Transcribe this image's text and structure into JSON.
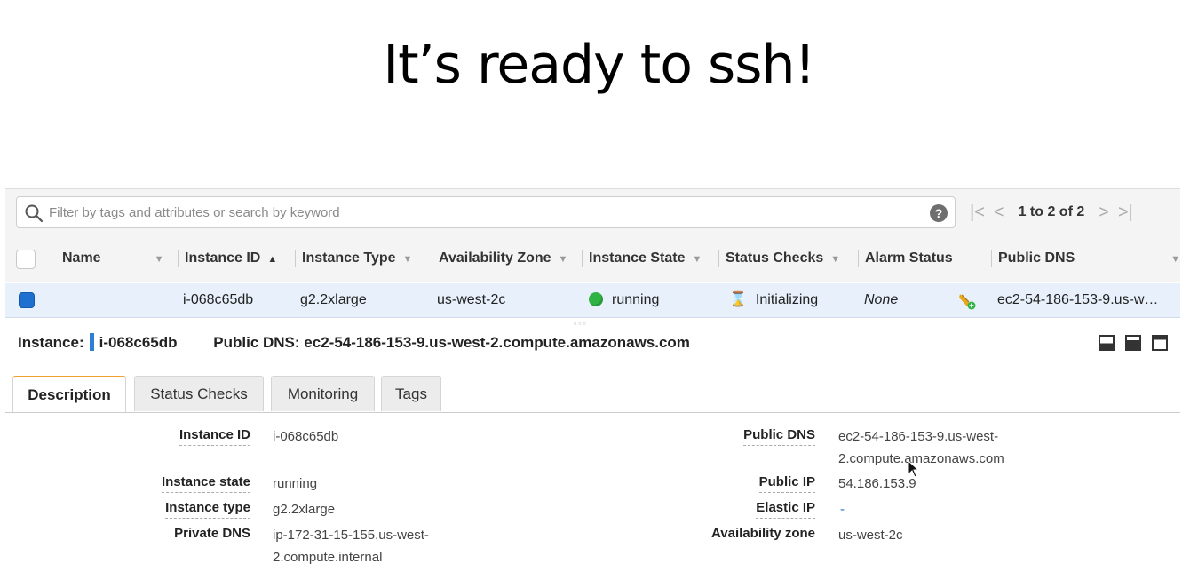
{
  "slide": {
    "title": "It’s ready to ssh!"
  },
  "search": {
    "placeholder": "Filter by tags and attributes or search by keyword"
  },
  "pager": {
    "first": "|<",
    "prev": "<",
    "count": "1 to 2 of 2",
    "next": ">",
    "last": ">|",
    "help": "?"
  },
  "table": {
    "columns": [
      "Name",
      "Instance ID",
      "Instance Type",
      "Availability Zone",
      "Instance State",
      "Status Checks",
      "Alarm Status",
      "Public DNS"
    ],
    "row": {
      "name": "",
      "instance_id": "i-068c65db",
      "instance_type": "g2.2xlarge",
      "zone": "us-west-2c",
      "state": "running",
      "status_checks": "Initializing",
      "alarm_status": "None",
      "public_dns": "ec2-54-186-153-9.us-w…"
    }
  },
  "detail": {
    "instance_label": "Instance:",
    "instance_id": "i-068c65db",
    "public_dns_label": "Public DNS:",
    "public_dns": "ec2-54-186-153-9.us-west-2.compute.amazonaws.com",
    "tabs": [
      "Description",
      "Status Checks",
      "Monitoring",
      "Tags"
    ],
    "fields_left": [
      {
        "key": "Instance ID",
        "value": "i-068c65db"
      },
      {
        "key": "Instance state",
        "value": "running"
      },
      {
        "key": "Instance type",
        "value": "g2.2xlarge"
      },
      {
        "key": "Private DNS",
        "value_line1": "ip-172-31-15-155.us-west-",
        "value_line2": "2.compute.internal"
      }
    ],
    "fields_right": [
      {
        "key": "Public DNS",
        "value_line1": "ec2-54-186-153-9.us-west-",
        "value_line2": "2.compute.amazonaws.com"
      },
      {
        "key": "Public IP",
        "value": "54.186.153.9"
      },
      {
        "key": "Elastic IP",
        "value": "-"
      },
      {
        "key": "Availability zone",
        "value": "us-west-2c"
      }
    ]
  },
  "colors": {
    "running_dot": "#2fb344",
    "selected_row": "#e8f1fb",
    "active_tab_accent": "#f0a030",
    "link": "#2a6fc9"
  }
}
